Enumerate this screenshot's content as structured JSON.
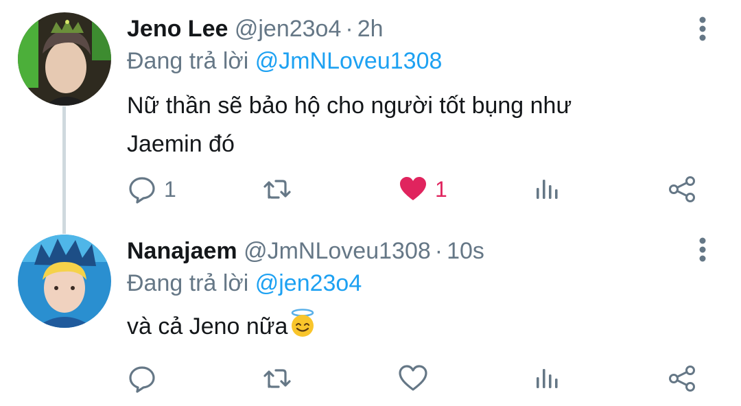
{
  "tweets": [
    {
      "display_name": "Jeno Lee",
      "handle": "@jen23o4",
      "separator": "·",
      "time": "2h",
      "reply_prefix": "Đang trả lời",
      "reply_to": "@JmNLoveu1308",
      "text_lines": [
        "Nữ thần sẽ bảo hộ cho người tốt bụng như",
        "Jaemin đó"
      ],
      "reply_count": "1",
      "retweet_count": "",
      "like_count": "1",
      "liked": true,
      "avatar": "profile-photo-crown-green"
    },
    {
      "display_name": "Nanajaem",
      "handle": "@JmNLoveu1308",
      "separator": "·",
      "time": "10s",
      "reply_prefix": "Đang trả lời",
      "reply_to": "@jen23o4",
      "text_lines": [
        "và cả Jeno nữa"
      ],
      "emoji": "smiling-face-with-halo",
      "reply_count": "",
      "retweet_count": "",
      "like_count": "",
      "liked": false,
      "avatar": "profile-photo-crown-blue"
    }
  ],
  "colors": {
    "text": "#14171a",
    "secondary": "#657786",
    "link": "#1da1f2",
    "like": "#e0245e",
    "thread_line": "#cfd9de"
  },
  "icons": [
    "more-vertical-icon",
    "reply-icon",
    "retweet-icon",
    "like-icon",
    "analytics-icon",
    "share-icon"
  ]
}
